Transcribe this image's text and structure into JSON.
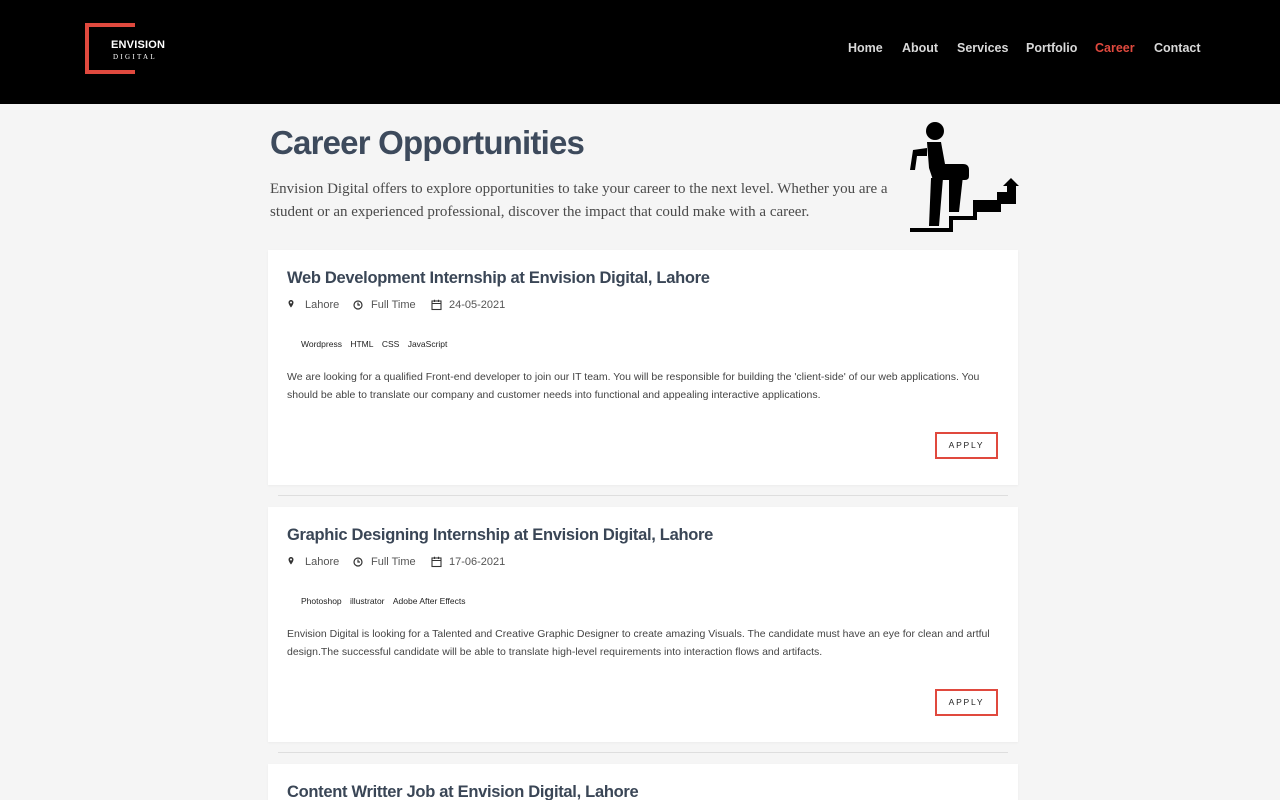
{
  "brand": {
    "line1": "ENVISION",
    "line2": "DIGITAL",
    "accent_color": "#e0493e"
  },
  "nav": {
    "items": [
      {
        "label": "Home",
        "active": false
      },
      {
        "label": "About",
        "active": false
      },
      {
        "label": "Services",
        "active": false
      },
      {
        "label": "Portfolio",
        "active": false
      },
      {
        "label": "Career",
        "active": true
      },
      {
        "label": "Contact",
        "active": false
      }
    ]
  },
  "intro": {
    "title": "Career Opportunities",
    "text": "Envision Digital offers to explore opportunities to take your career to the next level. Whether you are a student or an experienced professional, discover the impact that could make with a career.",
    "icon": "career-stairs-icon"
  },
  "jobs": [
    {
      "title": "Web Development Internship at Envision Digital, Lahore",
      "location": "Lahore",
      "type": "Full Time",
      "date": "24-05-2021",
      "tags": [
        "Wordpress",
        "HTML",
        "CSS",
        "JavaScript"
      ],
      "description": "We are looking for a qualified Front-end developer to join our IT team. You will be responsible for building the 'client-side' of our web applications. You should be able to translate our company and customer needs into functional and appealing interactive applications.",
      "apply_label": "APPLY"
    },
    {
      "title": "Graphic Designing Internship at Envision Digital, Lahore",
      "location": "Lahore",
      "type": "Full Time",
      "date": "17-06-2021",
      "tags": [
        "Photoshop",
        "illustrator",
        "Adobe After Effects"
      ],
      "description": "Envision Digital is looking for a Talented and Creative Graphic Designer to create amazing Visuals. The candidate must have an eye for clean and artful design.The successful candidate will be able to translate high-level requirements into interaction flows and artifacts.",
      "apply_label": "APPLY"
    },
    {
      "title": "Content Writter Job at Envision Digital, Lahore"
    }
  ]
}
